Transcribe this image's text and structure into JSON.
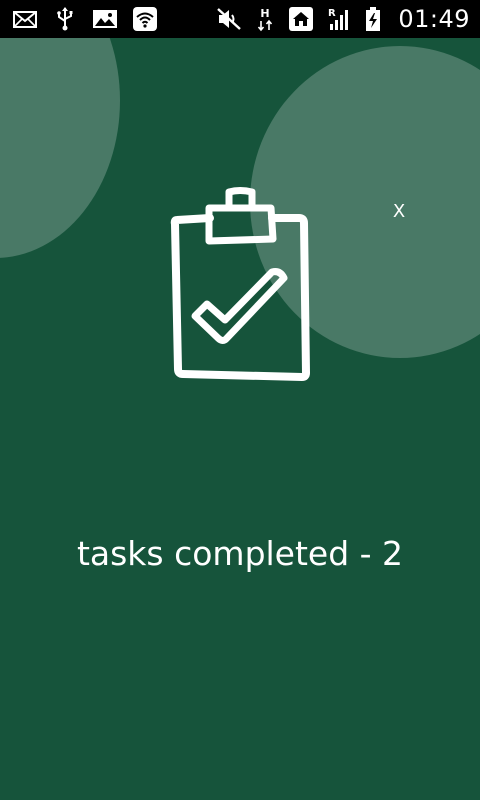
{
  "status_bar": {
    "left_icons": [
      "mail-icon",
      "usb-icon",
      "image-icon",
      "wifi-icon"
    ],
    "right_icons": [
      "vibrate-off-icon",
      "data-h-icon",
      "home-icon",
      "signal-roaming-icon",
      "battery-charging-icon"
    ],
    "data_indicator": "H",
    "roaming_indicator": "R",
    "time": "01:49"
  },
  "main": {
    "background_color": "#16543b",
    "close_label": "X",
    "message": "tasks completed - 2"
  }
}
